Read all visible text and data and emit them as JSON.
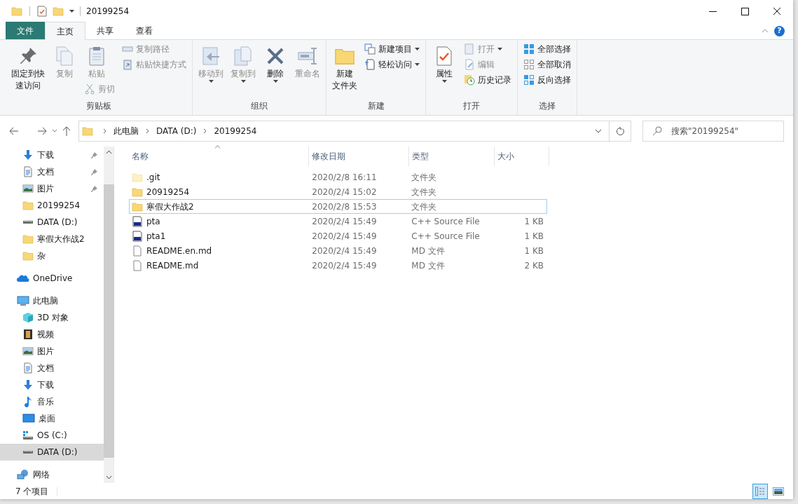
{
  "window": {
    "title": "20199254"
  },
  "ribbon_tabs": [
    {
      "label": "文件",
      "kind": "file",
      "selected": false
    },
    {
      "label": "主页",
      "kind": "tab",
      "selected": true
    },
    {
      "label": "共享",
      "kind": "tab",
      "selected": false
    },
    {
      "label": "查看",
      "kind": "tab",
      "selected": false
    }
  ],
  "help_button": "?",
  "ribbon_groups": [
    {
      "label": "剪贴板",
      "columns": [
        [
          {
            "kind": "large",
            "lines": [
              "固定到快",
              "速访问"
            ],
            "disabled": false,
            "dropdown": false
          }
        ],
        [
          {
            "kind": "large",
            "lines": [
              "复制"
            ],
            "disabled": true,
            "dropdown": false
          }
        ],
        [
          {
            "kind": "large",
            "lines": [
              "粘贴"
            ],
            "disabled": true,
            "dropdown": false
          },
          {
            "kind": "small",
            "lines": [
              "剪切"
            ],
            "disabled": true,
            "dropdown": false
          }
        ],
        [
          {
            "kind": "small",
            "lines": [
              "复制路径"
            ],
            "disabled": true,
            "dropdown": false
          },
          {
            "kind": "small",
            "lines": [
              "粘贴快捷方式"
            ],
            "disabled": true,
            "dropdown": false
          }
        ]
      ]
    },
    {
      "label": "组织",
      "columns": [
        [
          {
            "kind": "large",
            "lines": [
              "移动到"
            ],
            "disabled": true,
            "dropdown": true
          }
        ],
        [
          {
            "kind": "large",
            "lines": [
              "复制到"
            ],
            "disabled": true,
            "dropdown": true
          }
        ],
        [
          {
            "kind": "large",
            "lines": [
              "删除"
            ],
            "disabled": false,
            "dropdown": true
          }
        ],
        [
          {
            "kind": "large",
            "lines": [
              "重命名"
            ],
            "disabled": true,
            "dropdown": false
          }
        ]
      ]
    },
    {
      "label": "新建",
      "columns": [
        [
          {
            "kind": "large",
            "lines": [
              "新建",
              "文件夹"
            ],
            "disabled": false,
            "dropdown": false
          }
        ],
        [
          {
            "kind": "small",
            "lines": [
              "新建项目"
            ],
            "disabled": false,
            "dropdown": true
          },
          {
            "kind": "small",
            "lines": [
              "轻松访问"
            ],
            "disabled": false,
            "dropdown": true
          }
        ]
      ]
    },
    {
      "label": "打开",
      "columns": [
        [
          {
            "kind": "large",
            "lines": [
              "属性"
            ],
            "disabled": false,
            "dropdown": true
          }
        ],
        [
          {
            "kind": "small",
            "lines": [
              "打开"
            ],
            "disabled": true,
            "dropdown": true
          },
          {
            "kind": "small",
            "lines": [
              "编辑"
            ],
            "disabled": true,
            "dropdown": false
          },
          {
            "kind": "small",
            "lines": [
              "历史记录"
            ],
            "disabled": false,
            "dropdown": false
          }
        ]
      ]
    },
    {
      "label": "选择",
      "columns": [
        [
          {
            "kind": "small",
            "lines": [
              "全部选择"
            ],
            "disabled": false,
            "dropdown": false
          },
          {
            "kind": "small",
            "lines": [
              "全部取消"
            ],
            "disabled": false,
            "dropdown": false
          },
          {
            "kind": "small",
            "lines": [
              "反向选择"
            ],
            "disabled": false,
            "dropdown": false
          }
        ]
      ]
    }
  ],
  "address": {
    "crumbs": [
      "此电脑",
      "DATA (D:)",
      "20199254"
    ]
  },
  "search": {
    "placeholder": "搜索\"20199254\""
  },
  "quick_access": [
    {
      "label": "下载",
      "pinned": true,
      "selected": false
    },
    {
      "label": "文档",
      "pinned": true,
      "selected": false
    },
    {
      "label": "图片",
      "pinned": true,
      "selected": false
    },
    {
      "label": "20199254",
      "pinned": false,
      "selected": false
    },
    {
      "label": "DATA (D:)",
      "pinned": false,
      "selected": false
    },
    {
      "label": "寒假大作战2",
      "pinned": false,
      "selected": false
    },
    {
      "label": "杂",
      "pinned": false,
      "selected": false
    }
  ],
  "navigation": [
    {
      "label": "OneDrive",
      "selected": false
    },
    {
      "label": "此电脑",
      "selected": false,
      "children": [
        {
          "label": "3D 对象",
          "selected": false
        },
        {
          "label": "视频",
          "selected": false
        },
        {
          "label": "图片",
          "selected": false
        },
        {
          "label": "文档",
          "selected": false
        },
        {
          "label": "下载",
          "selected": false
        },
        {
          "label": "音乐",
          "selected": false
        },
        {
          "label": "桌面",
          "selected": false
        },
        {
          "label": "OS (C:)",
          "selected": false
        },
        {
          "label": "DATA (D:)",
          "selected": true
        }
      ]
    },
    {
      "label": "网络",
      "selected": false
    }
  ],
  "file_list": {
    "columns": [
      "名称",
      "修改日期",
      "类型",
      "大小"
    ],
    "rows": [
      {
        "name": ".git",
        "date": "2020/2/8 16:11",
        "type": "文件夹",
        "size": "",
        "kind": "hidden-folder",
        "focused": false
      },
      {
        "name": "20919254",
        "date": "2020/2/4 15:02",
        "type": "文件夹",
        "size": "",
        "kind": "folder",
        "focused": false
      },
      {
        "name": "寒假大作战2",
        "date": "2020/2/8 15:53",
        "type": "文件夹",
        "size": "",
        "kind": "folder",
        "focused": true
      },
      {
        "name": "pta",
        "date": "2020/2/4 15:49",
        "type": "C++ Source File",
        "size": "1 KB",
        "kind": "cpp",
        "focused": false
      },
      {
        "name": "pta1",
        "date": "2020/2/4 15:49",
        "type": "C++ Source File",
        "size": "1 KB",
        "kind": "cpp",
        "focused": false
      },
      {
        "name": "README.en.md",
        "date": "2020/2/4 15:49",
        "type": "MD 文件",
        "size": "1 KB",
        "kind": "file",
        "focused": false
      },
      {
        "name": "README.md",
        "date": "2020/2/4 15:49",
        "type": "MD 文件",
        "size": "2 KB",
        "kind": "file",
        "focused": false
      }
    ]
  },
  "status_bar": {
    "item_count": "7 个项目",
    "views": [
      {
        "kind": "details",
        "selected": true
      },
      {
        "kind": "large-icons",
        "selected": false
      }
    ]
  }
}
